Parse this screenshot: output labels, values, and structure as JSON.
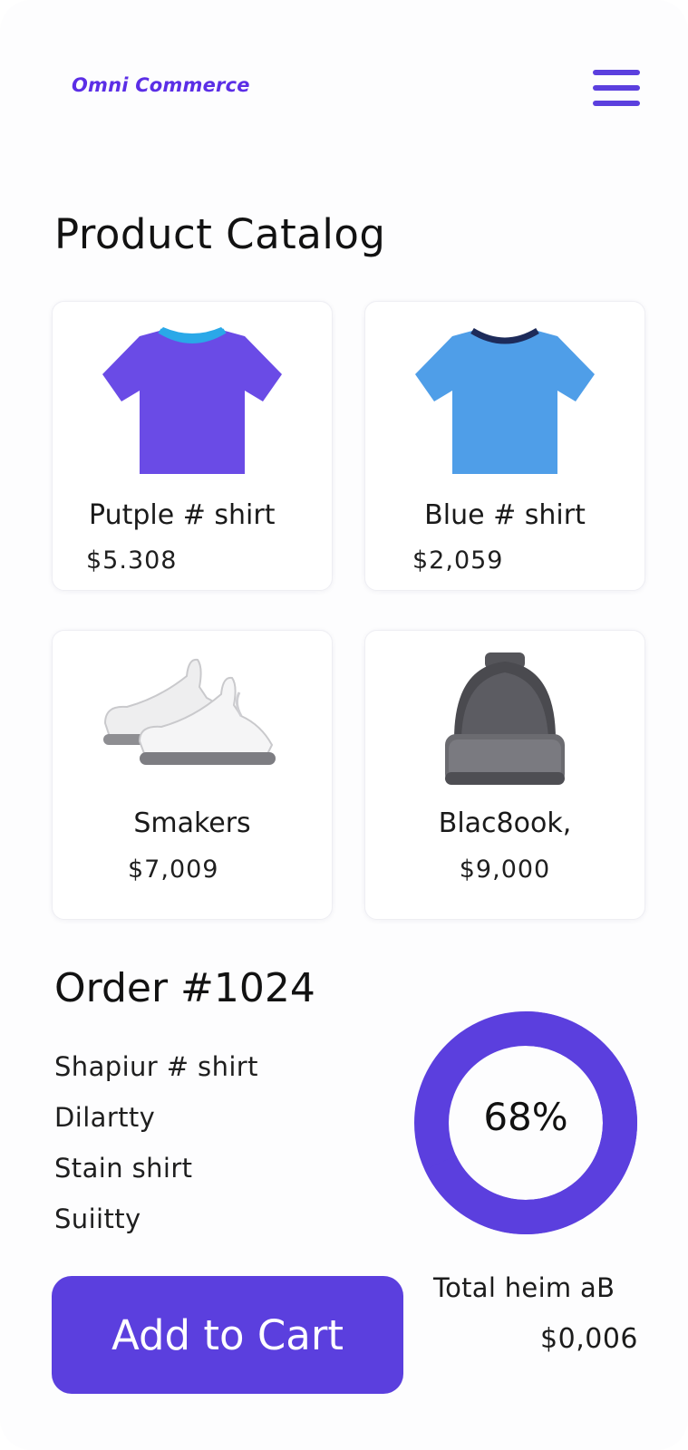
{
  "app": {
    "brand": "Omni Commerce",
    "menu_icon": "hamburger-menu-icon",
    "accent_color": "#5b3fde"
  },
  "catalog": {
    "title": "Product Catalog",
    "products": [
      {
        "name": "Putple # shirt",
        "price": "$5.308",
        "icon": "tshirt-purple-icon",
        "color": "#6a4be6",
        "collar_color": "#2aa8e8"
      },
      {
        "name": "Blue # shirt",
        "price": "$2,059",
        "icon": "tshirt-blue-icon",
        "color": "#4f9ee8",
        "collar_color": "#1d2b5a"
      },
      {
        "name": "Smakers",
        "price": "$7,009",
        "icon": "sneakers-icon"
      },
      {
        "name": "Blac8ook,",
        "price": "$9,000",
        "icon": "beanie-icon"
      }
    ]
  },
  "order": {
    "title": "Order #1024",
    "lines": [
      "Shapiur # shirt",
      "Dilartty",
      "Stain shirt",
      "Suiitty"
    ],
    "progress_percent": 68,
    "progress_label": "68%",
    "add_to_cart_label": "Add to Cart",
    "total_label": "Total heim aB",
    "total_value": "$0,006"
  }
}
